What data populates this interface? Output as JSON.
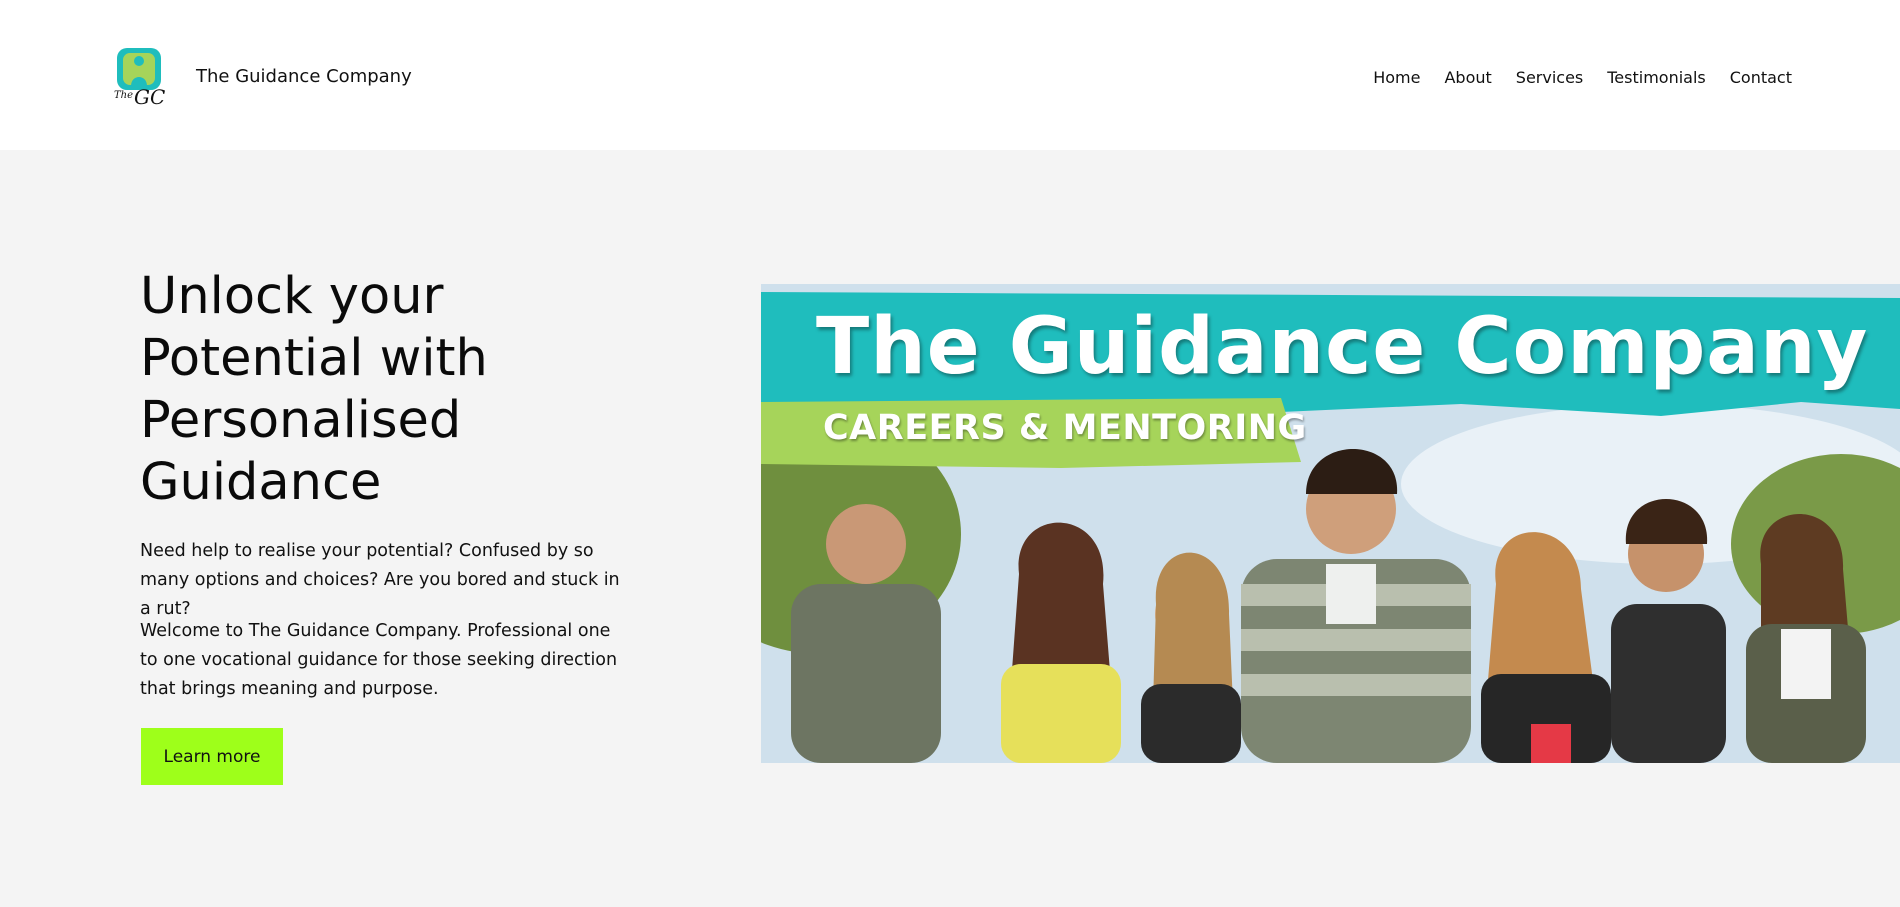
{
  "header": {
    "logo_name": "the-gc-logo",
    "logo_text": "TheGC",
    "brand": "The Guidance Company",
    "nav": [
      "Home",
      "About",
      "Services",
      "Testimonials",
      "Contact"
    ]
  },
  "hero": {
    "headline": "Unlock your Potential with Personalised Guidance",
    "paragraph1": "Need help to realise your potential? Confused by so many options and choices? Are you bored and stuck in a rut?",
    "paragraph2": "Welcome to The Guidance Company. Professional one to one vocational guidance for those seeking direction that brings meaning and purpose.",
    "button": "Learn more"
  },
  "banner": {
    "title": "The Guidance Company",
    "subtitle": "CAREERS & MENTORING"
  },
  "colors": {
    "accent": "#9eff1a",
    "teal": "#1fbdbd",
    "green": "#a6d45a",
    "header_bg": "#ffffff",
    "page_bg": "#f4f4f4"
  }
}
